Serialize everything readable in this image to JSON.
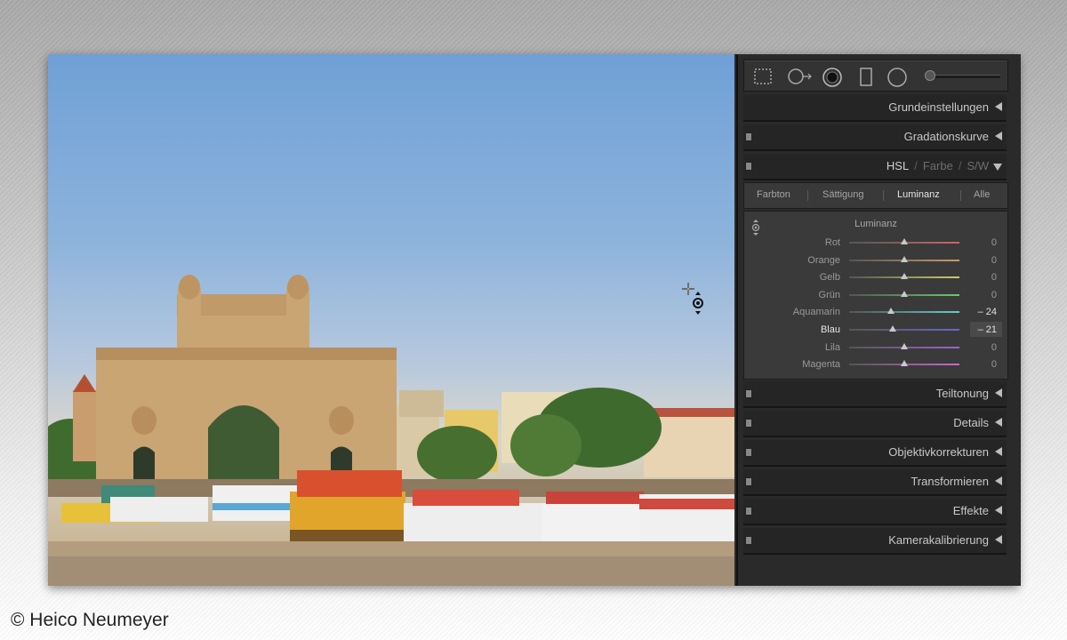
{
  "toolbar": {
    "tools": [
      "crop-overlay-icon",
      "spot-removal-icon",
      "red-eye-icon",
      "graduated-filter-icon",
      "radial-filter-icon",
      "adjustment-brush-icon"
    ]
  },
  "sections_top": [
    {
      "title": "Grundeinstellungen"
    },
    {
      "title": "Gradationskurve"
    }
  ],
  "hsl": {
    "modes": [
      "HSL",
      "Farbe",
      "S/W"
    ],
    "separator": "/",
    "tabs": [
      "Farbton",
      "Sättigung",
      "Luminanz",
      "Alle"
    ],
    "active_tab": "Luminanz",
    "group_title": "Luminanz",
    "sliders": [
      {
        "label": "Rot",
        "value": "0",
        "level": 0
      },
      {
        "label": "Orange",
        "value": "0",
        "level": 0
      },
      {
        "label": "Gelb",
        "value": "0",
        "level": 0
      },
      {
        "label": "Grün",
        "value": "0",
        "level": 0
      },
      {
        "label": "Aquamarin",
        "value": "– 24",
        "level": -24
      },
      {
        "label": "Blau",
        "value": "– 21",
        "level": -21
      },
      {
        "label": "Lila",
        "value": "0",
        "level": 0
      },
      {
        "label": "Magenta",
        "value": "0",
        "level": 0
      }
    ],
    "highlighted": "Blau"
  },
  "sections_bottom": [
    {
      "title": "Teiltonung"
    },
    {
      "title": "Details"
    },
    {
      "title": "Objektivkorrekturen"
    },
    {
      "title": "Transformieren"
    },
    {
      "title": "Effekte"
    },
    {
      "title": "Kamerakalibrierung"
    }
  ],
  "credit": "© Heico Neumeyer",
  "colors": {
    "panel_bg": "#2a2a2a",
    "slider_bg": "#3a3a3a",
    "text": "#c8c8c8"
  }
}
